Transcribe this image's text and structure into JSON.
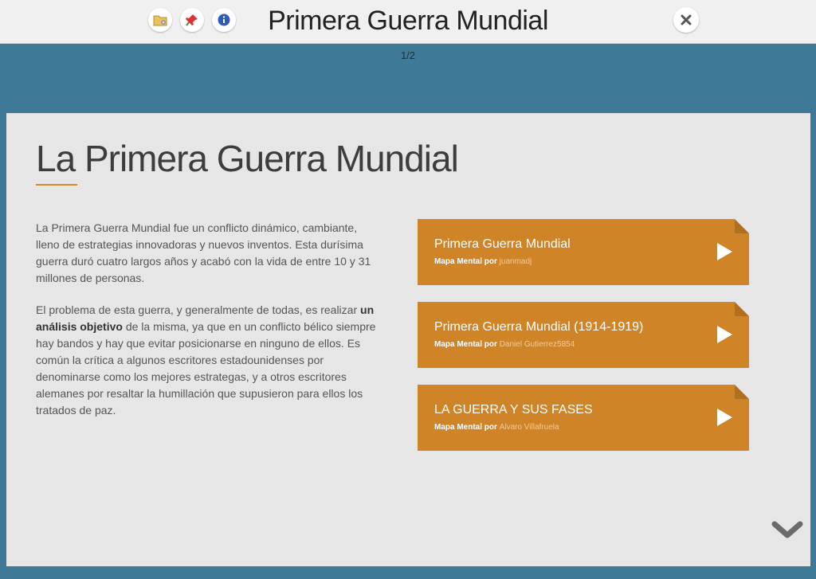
{
  "header": {
    "title": "Primera Guerra Mundial",
    "tools": [
      {
        "icon": "folder-icon"
      },
      {
        "icon": "pin-icon"
      },
      {
        "icon": "info-icon"
      }
    ],
    "close_icon": "close-icon"
  },
  "pager": {
    "label": "1/2"
  },
  "slide": {
    "title": "La Primera Guerra Mundial",
    "para1": "La Primera Guerra Mundial fue un conflicto dinámico, cambiante, lleno de estrategias innovadoras y nuevos inventos. Esta durísima guerra duró cuatro largos años y acabó con la vida de entre 10 y 31 millones de personas.",
    "para2_before": "El problema de esta guerra, y generalmente de todas, es realizar ",
    "para2_bold": "un análisis objetivo",
    "para2_after": " de la misma, ya que en un conflicto bélico siempre hay bandos y hay que evitar posicionarse en ninguno de ellos. Es común la crítica a algunos escritores estadounidenses por denominarse como los mejores estrategas, y a otros escritores alemanes por resaltar la humillación que supusieron para ellos los tratados de paz."
  },
  "cards": [
    {
      "title": "Primera Guerra Mundial",
      "type": "Mapa Mental por",
      "author": "juanmadj"
    },
    {
      "title": "Primera Guerra Mundial (1914-1919)",
      "type": "Mapa Mental por",
      "author": "Daniel Gutierrez5854"
    },
    {
      "title": "LA GUERRA Y SUS FASES",
      "type": "Mapa Mental por",
      "author": "Alvaro Villafruela"
    }
  ],
  "colors": {
    "accent": "#d08428",
    "background": "#3e7a98",
    "panel": "#e6e6e6"
  },
  "scroll_icon": "chevron-down-icon"
}
